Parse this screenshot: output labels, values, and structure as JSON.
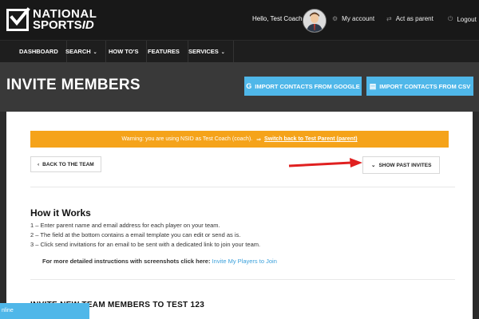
{
  "brand": {
    "line1": "NATIONAL",
    "line2": "SPORTS",
    "line2_suffix": "ID"
  },
  "header": {
    "greeting": "Hello, Test Coach",
    "links": [
      {
        "label": "My account",
        "icon": "gear-icon"
      },
      {
        "label": "Act as parent",
        "icon": "switch-icon"
      },
      {
        "label": "Logout",
        "icon": "logout-icon"
      }
    ]
  },
  "nav": [
    {
      "label": "DASHBOARD"
    },
    {
      "label": "SEARCH",
      "caret": "⌄"
    },
    {
      "label": "HOW TO'S"
    },
    {
      "label": "FEATURES"
    },
    {
      "label": "SERVICES",
      "caret": "⌄"
    }
  ],
  "page": {
    "title": "INVITE MEMBERS",
    "import_google": "IMPORT CONTACTS FROM GOOGLE",
    "import_csv": "IMPORT CONTACTS FROM CSV"
  },
  "warning": {
    "text": "Warning: you are using NSID as Test Coach (coach).",
    "switch_label": "Switch back to Test Parent (parent)"
  },
  "buttons": {
    "back": "BACK TO THE TEAM",
    "past": "SHOW PAST INVITES"
  },
  "how": {
    "title": "How it Works",
    "steps": [
      "1 – Enter parent name and email address for each player on your team.",
      "2 – The field at the bottom contains a email template you can edit or send as is.",
      "3 – Click send invitations for an email to be sent with a dedicated link to join your team."
    ],
    "more_text": "For more detailed instructions with screenshots click here:",
    "more_link": "Invite My Players to Join"
  },
  "invite_section_title": "INVITE NEW TEAM MEMBERS TO TEST 123",
  "status": {
    "online": "nline"
  },
  "colors": {
    "accent": "#4fb7e9",
    "warning": "#f5a31a",
    "arrow": "#e02020"
  }
}
